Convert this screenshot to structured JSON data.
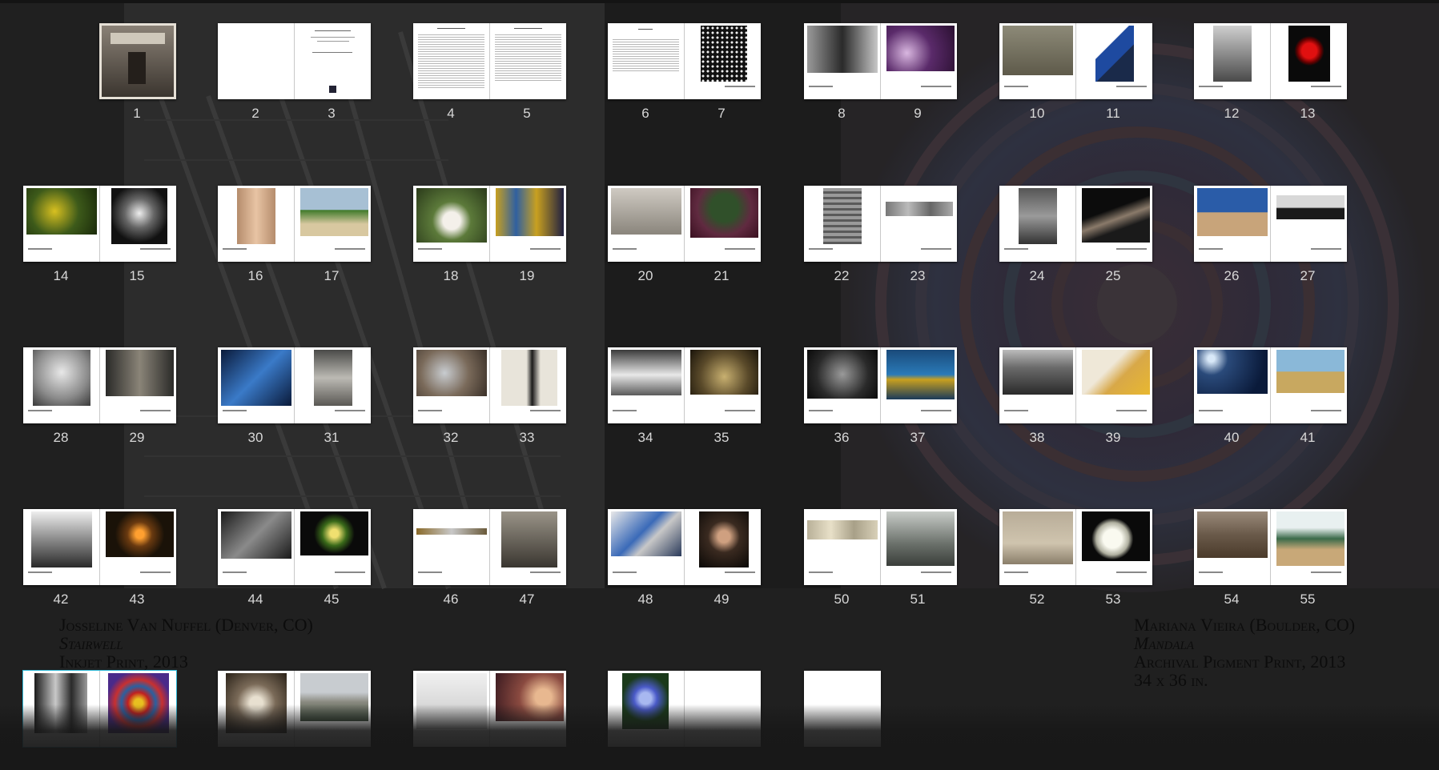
{
  "window": {
    "background": "#222222",
    "accent": "#2fb9d8"
  },
  "spreads": [
    {
      "pages": [
        "",
        "1"
      ]
    },
    {
      "pages": [
        "2",
        "3"
      ]
    },
    {
      "pages": [
        "4",
        "5"
      ]
    },
    {
      "pages": [
        "6",
        "7"
      ]
    },
    {
      "pages": [
        "8",
        "9"
      ]
    },
    {
      "pages": [
        "10",
        "11"
      ]
    },
    {
      "pages": [
        "12",
        "13"
      ]
    },
    {
      "pages": [
        "14",
        "15"
      ]
    },
    {
      "pages": [
        "16",
        "17"
      ]
    },
    {
      "pages": [
        "18",
        "19"
      ]
    },
    {
      "pages": [
        "20",
        "21"
      ]
    },
    {
      "pages": [
        "22",
        "23"
      ]
    },
    {
      "pages": [
        "24",
        "25"
      ]
    },
    {
      "pages": [
        "26",
        "27"
      ]
    },
    {
      "pages": [
        "28",
        "29"
      ]
    },
    {
      "pages": [
        "30",
        "31"
      ]
    },
    {
      "pages": [
        "32",
        "33"
      ]
    },
    {
      "pages": [
        "34",
        "35"
      ]
    },
    {
      "pages": [
        "36",
        "37"
      ]
    },
    {
      "pages": [
        "38",
        "39"
      ]
    },
    {
      "pages": [
        "40",
        "41"
      ]
    },
    {
      "pages": [
        "42",
        "43"
      ]
    },
    {
      "pages": [
        "44",
        "45"
      ]
    },
    {
      "pages": [
        "46",
        "47"
      ]
    },
    {
      "pages": [
        "48",
        "49"
      ]
    },
    {
      "pages": [
        "50",
        "51"
      ]
    },
    {
      "pages": [
        "52",
        "53"
      ]
    },
    {
      "pages": [
        "54",
        "55"
      ]
    },
    {
      "pages": [
        "",
        ""
      ],
      "selected": true
    },
    {
      "pages": [
        "",
        ""
      ]
    },
    {
      "pages": [
        "",
        ""
      ]
    },
    {
      "pages": [
        "",
        ""
      ]
    },
    {
      "pages": [
        "",
        ""
      ]
    }
  ],
  "captions": {
    "left": {
      "artist": "Josseline Van Nuffel",
      "location": "(Denver, CO)",
      "title": "Stairwell",
      "medium": "Inkjet Print, 2013"
    },
    "right": {
      "artist": "Mariana Vieira",
      "location": "(Boulder, CO)",
      "title": "Mandala",
      "medium": "Archival Pigment Print, 2013",
      "size": "34 x 36 in."
    }
  },
  "page3": {
    "line1": "2014 Members' Show",
    "line2": "Exhibition Juror: Anne Ryan"
  },
  "page6": {
    "heading": "Abstract"
  }
}
